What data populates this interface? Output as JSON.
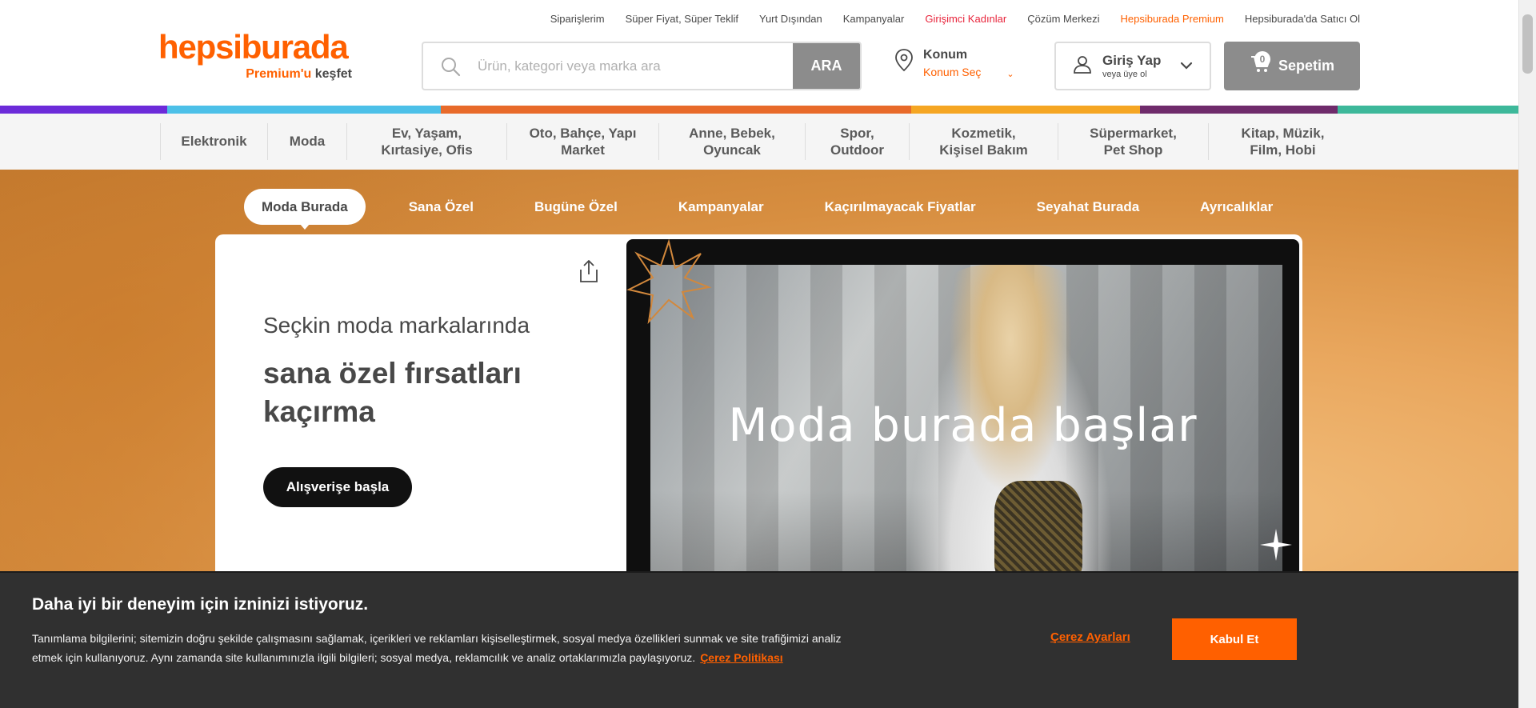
{
  "top_links": [
    {
      "label": "Siparişlerim",
      "color": "default"
    },
    {
      "label": "Süper Fiyat, Süper Teklif",
      "color": "default"
    },
    {
      "label": "Yurt Dışından",
      "color": "default"
    },
    {
      "label": "Kampanyalar",
      "color": "default"
    },
    {
      "label": "Girişimci Kadınlar",
      "color": "red"
    },
    {
      "label": "Çözüm Merkezi",
      "color": "default"
    },
    {
      "label": "Hepsiburada Premium",
      "color": "orange"
    },
    {
      "label": "Hepsiburada'da Satıcı Ol",
      "color": "default"
    }
  ],
  "logo": {
    "brand": "hepsiburada",
    "tagline_accent": "Premium'u",
    "tagline_rest": "keşfet"
  },
  "search": {
    "placeholder": "Ürün, kategori veya marka ara",
    "button": "ARA"
  },
  "location": {
    "title": "Konum",
    "action": "Konum Seç"
  },
  "account": {
    "title": "Giriş Yap",
    "subtitle": "veya üye ol"
  },
  "cart": {
    "label": "Sepetim",
    "count": "0"
  },
  "stripe_colors": [
    "#6c2bd9",
    "#4cc0e8",
    "#e86a2a",
    "#f5a623",
    "#6f2b6b",
    "#3db89a"
  ],
  "categories": [
    {
      "line1": "Elektronik",
      "line2": ""
    },
    {
      "line1": "Moda",
      "line2": ""
    },
    {
      "line1": "Ev, Yaşam,",
      "line2": "Kırtasiye, Ofis"
    },
    {
      "line1": "Oto, Bahçe, Yapı",
      "line2": "Market"
    },
    {
      "line1": "Anne, Bebek,",
      "line2": "Oyuncak"
    },
    {
      "line1": "Spor,",
      "line2": "Outdoor"
    },
    {
      "line1": "Kozmetik,",
      "line2": "Kişisel Bakım"
    },
    {
      "line1": "Süpermarket,",
      "line2": "Pet Shop"
    },
    {
      "line1": "Kitap, Müzik,",
      "line2": "Film, Hobi"
    }
  ],
  "hero_tabs": [
    "Moda Burada",
    "Sana Özel",
    "Bugüne Özel",
    "Kampanyalar",
    "Kaçırılmayacak Fiyatlar",
    "Seyahat Burada",
    "Ayrıcalıklar"
  ],
  "hero": {
    "subtitle": "Seçkin moda markalarında",
    "headline": "sana özel fırsatları kaçırma",
    "cta": "Alışverişe başla",
    "banner_text": "Moda burada başlar"
  },
  "cookie": {
    "title": "Daha iyi bir deneyim için izninizi istiyoruz.",
    "body": "Tanımlama bilgilerini; sitemizin doğru şekilde çalışmasını sağlamak, içerikleri ve reklamları kişiselleştirmek, sosyal medya özellikleri sunmak ve site trafiğimizi analiz etmek için kullanıyoruz. Aynı zamanda site kullanımınızla ilgili bilgileri; sosyal medya, reklamcılık ve analiz ortaklarımızla paylaşıyoruz.",
    "policy_link": "Çerez Politikası",
    "settings": "Çerez Ayarları",
    "accept": "Kabul Et"
  },
  "colors": {
    "brand": "#ff6000",
    "dark_text": "#484848",
    "cookie_bg": "#303030"
  }
}
